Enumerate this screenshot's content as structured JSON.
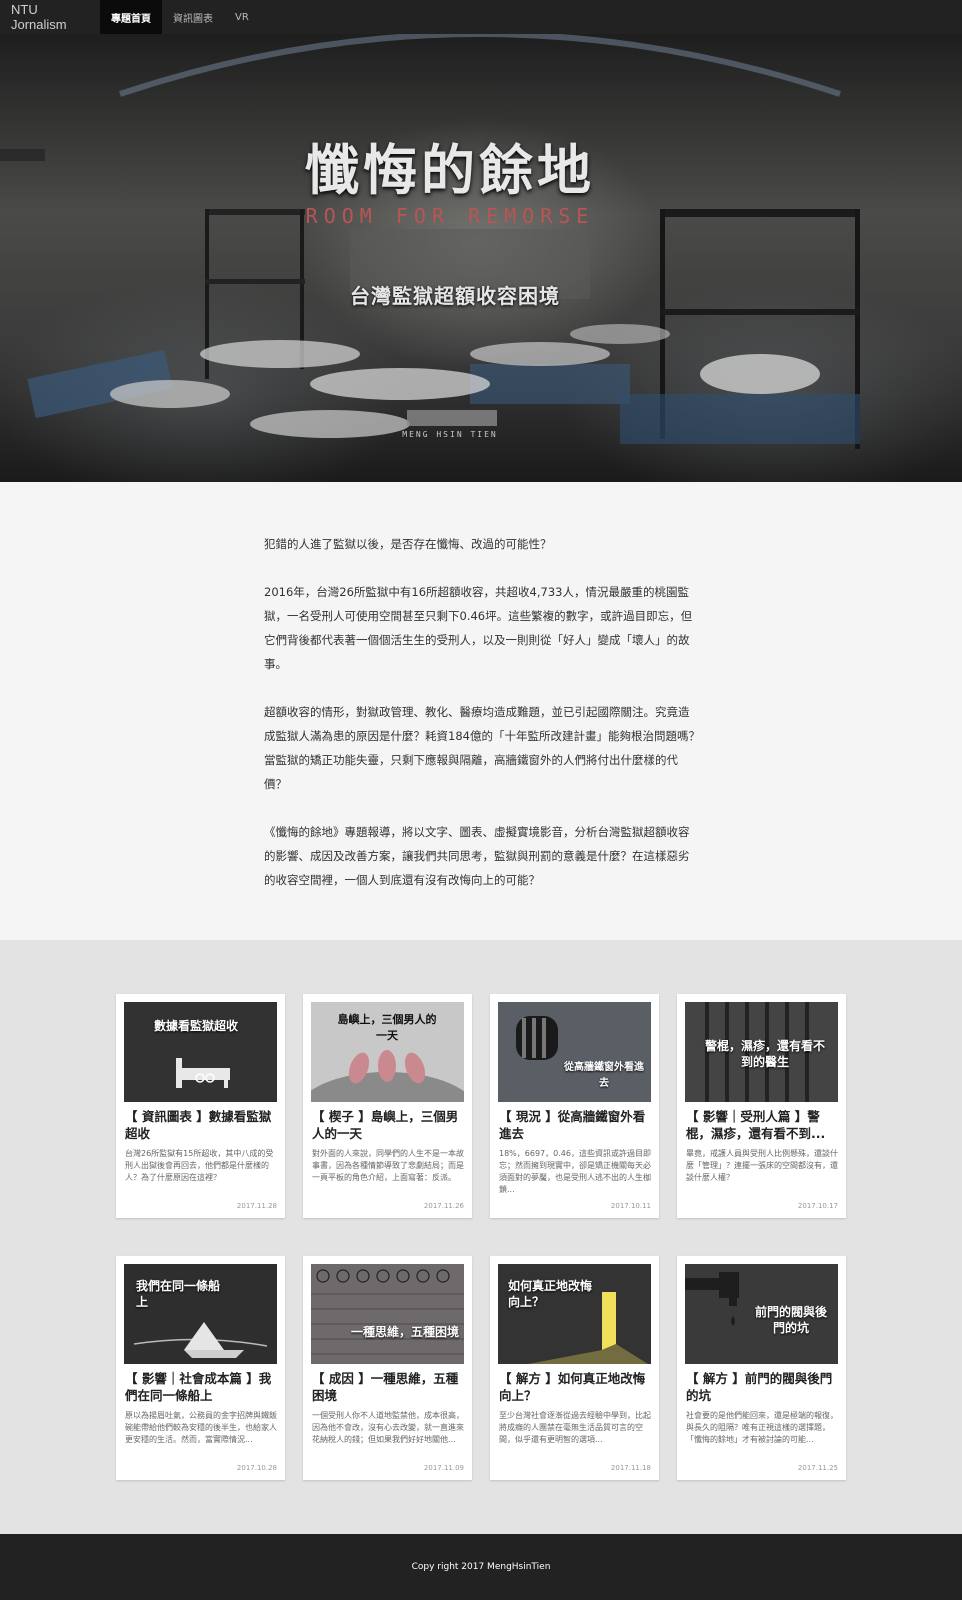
{
  "nav": {
    "brand": "NTU Jornalism",
    "items": [
      "專題首頁",
      "資訊圖表",
      "VR"
    ]
  },
  "hero": {
    "title": "懺悔的餘地",
    "subtitle": "ROOM FOR REMORSE",
    "tagline": "台灣監獄超額收容困境",
    "author": "MENG HSIN TIEN"
  },
  "intro": {
    "paragraphs": [
      "犯錯的人進了監獄以後，是否存在懺悔、改過的可能性？",
      "2016年，台灣26所監獄中有16所超額收容，共超收4,733人，情況最嚴重的桃園監獄，一名受刑人可使用空間甚至只剩下0.46坪。這些繁複的數字，或許過目即忘，但它們背後都代表著一個個活生生的受刑人，以及一則則從「好人」變成「壞人」的故事。",
      "超額收容的情形，對獄政管理、教化、醫療均造成難題，並已引起國際關注。究竟造成監獄人滿為患的原因是什麼？耗資184億的「十年監所改建計畫」能夠根治問題嗎？當監獄的矯正功能失靈，只剩下應報與隔離，高牆鐵窗外的人們將付出什麼樣的代價？",
      "《懺悔的餘地》專題報導，將以文字、圖表、虛擬實境影音，分析台灣監獄超額收容的影響、成因及改善方案，讓我們共同思考，監獄與刑罰的意義是什麼？在這樣惡劣的收容空間裡，一個人到底還有沒有改悔向上的可能？"
    ]
  },
  "cards": [
    {
      "thumb": "數據看監獄超收",
      "title": "【 資訊圖表 】數據看監獄超收",
      "excerpt": "台灣26所監獄有15所超收，其中八成的受刑人出獄後會再回去，他們都是什麼樣的人？為了什麼原因在這裡？",
      "date": "2017.11.28"
    },
    {
      "thumb": "島嶼上，三個男人的一天",
      "title": "【 楔子 】島嶼上，三個男人的一天",
      "excerpt": "對外面的人來說，同學們的人生不是一本故事書，因為各種情節導致了悲劇結局；而是一頁平板的角色介紹，上面寫著：反派。",
      "date": "2017.11.26"
    },
    {
      "thumb": "從高牆鐵窗外看進去",
      "title": "【 現況 】從高牆鐵窗外看進去",
      "excerpt": "18%，6697，0.46，這些資訊或許過目即忘；然而擁到現實中，卻是矯正機關每天必須面對的夢魘，也是受刑人逃不出的人生枷鎖...",
      "date": "2017.10.11"
    },
    {
      "thumb": "警棍，濕疹，還有看不到的醫生",
      "title": "【 影響｜受刑人篇 】警棍，濕疹，還有看不到...",
      "excerpt": "畢竟，戒護人員與受刑人比例懸殊，還談什麼「管理」？連擺一張床的空間都沒有，還談什麼人權？",
      "date": "2017.10.17"
    },
    {
      "thumb": "我們在同一條船上",
      "title": "【 影響｜社會成本篇 】我們在同一條船上",
      "excerpt": "原以為揚眉吐氣，公務員的金字招牌與鐵飯碗能帶給他們較為安穩的後半生，也給家人更安穩的生活。然而，當實際情況...",
      "date": "2017.10.28"
    },
    {
      "thumb": "一種思維，五種困境",
      "title": "【 成因 】一種思維，五種困境",
      "excerpt": "一個受刑人你不人道地監禁他，成本很高，因為他不會改，沒有心去改變，就一直進來花納稅人的錢；但如果我們好好地關他...",
      "date": "2017.11.09"
    },
    {
      "thumb": "如何真正地改悔向上？",
      "title": "【 解方 】如何真正地改悔向上？",
      "excerpt": "至少台灣社會逐漸從過去經驗中學到，比起將成癮的人團禁在毫無生活品質可言的空間，似乎還有更明智的選項...",
      "date": "2017.11.18"
    },
    {
      "thumb": "前門的閥與後門的坑",
      "title": "【 解方 】前門的閥與後門的坑",
      "excerpt": "社會要的是他們能回來，還是極端的報復，與長久的阻隔？唯有正視這樣的選擇題，「懺悔的餘地」才有被討論的可能...",
      "date": "2017.11.25"
    }
  ],
  "footer": {
    "text": "Copy right 2017 MengHsinTien"
  },
  "colors": {
    "nav_bg": "#222222",
    "nav_active": "#0b0b0b",
    "card_bg": "#ffffff",
    "section_bg": "#e3e3e3",
    "accent_red": "#b85555"
  }
}
